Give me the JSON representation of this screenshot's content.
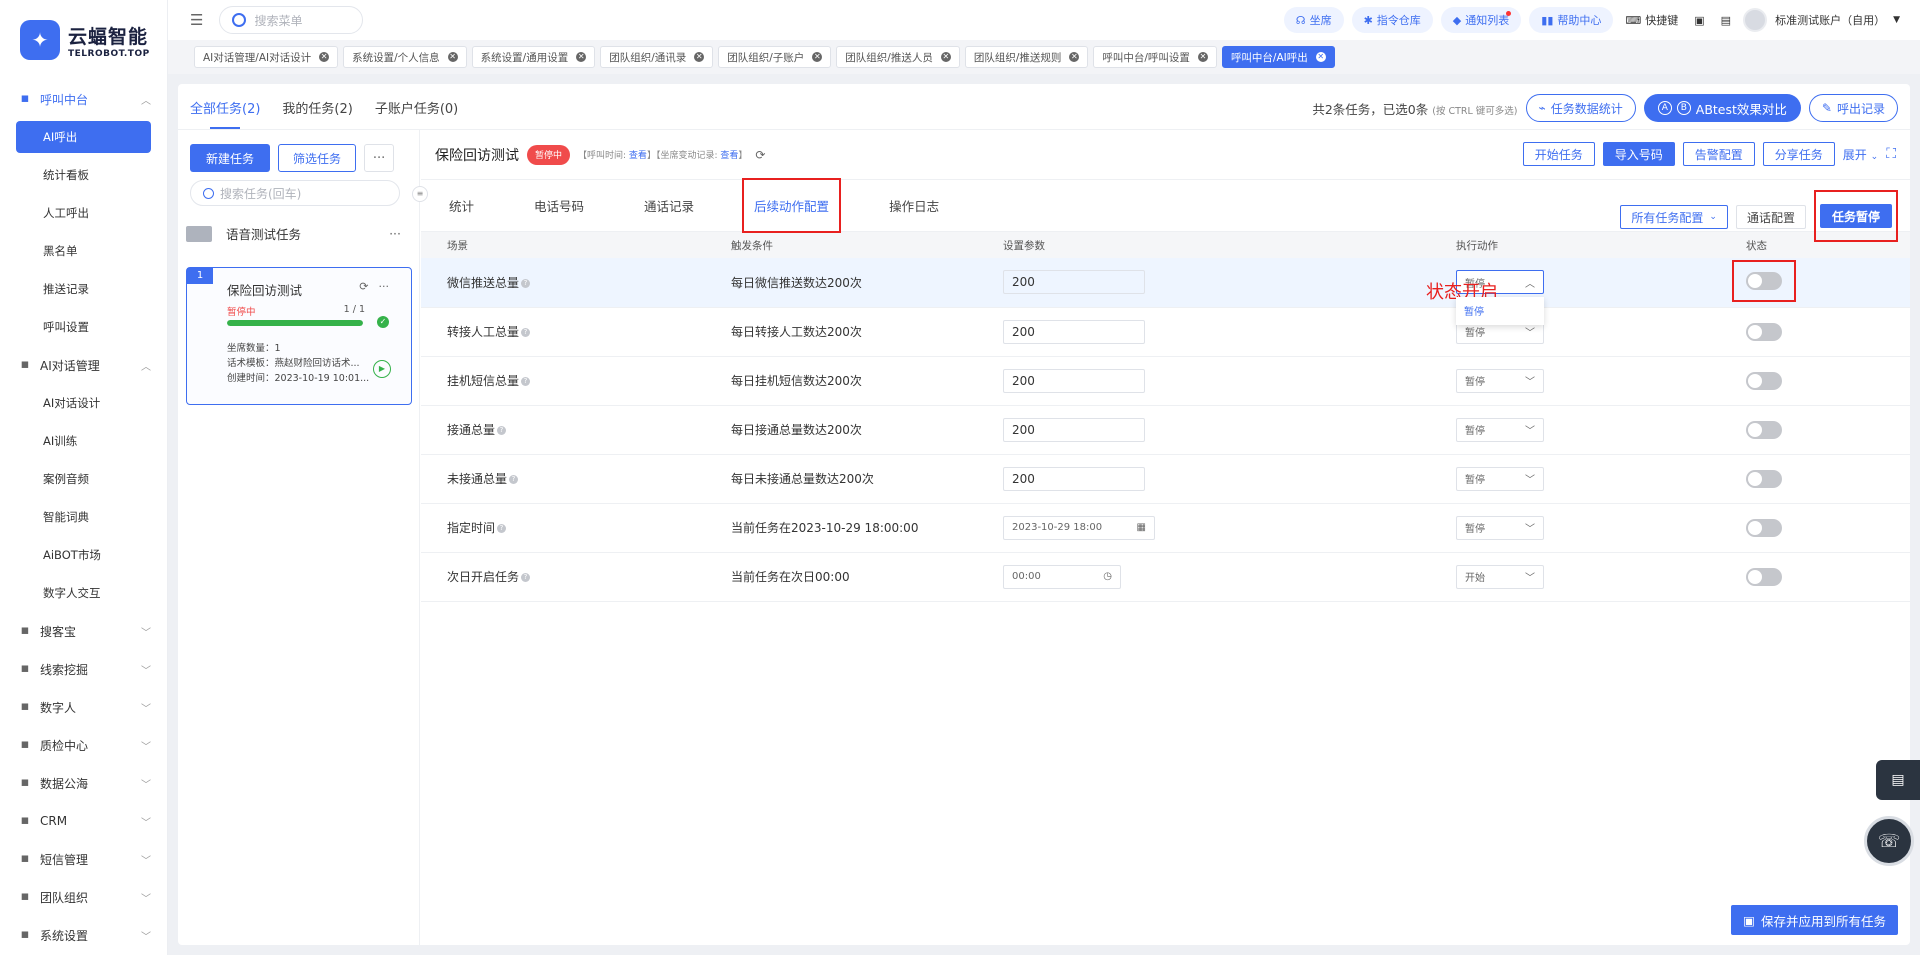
{
  "logo": {
    "title": "云蝠智能",
    "sub": "TELROBOT.TOP"
  },
  "sidebar": {
    "groups": [
      {
        "label": "呼叫中台",
        "icon": "monitor-icon",
        "active": true,
        "subs": [
          {
            "label": "AI呼出",
            "active": true
          },
          {
            "label": "统计看板"
          },
          {
            "label": "人工呼出"
          },
          {
            "label": "黑名单"
          },
          {
            "label": "推送记录"
          },
          {
            "label": "呼叫设置"
          }
        ]
      },
      {
        "label": "AI对话管理",
        "icon": "grid-icon",
        "subs": [
          {
            "label": "AI对话设计"
          },
          {
            "label": "AI训练"
          },
          {
            "label": "案例音频"
          },
          {
            "label": "智能词典"
          },
          {
            "label": "AiBOT市场"
          },
          {
            "label": "数字人交互"
          }
        ]
      },
      {
        "label": "搜客宝",
        "icon": "search-icon"
      },
      {
        "label": "线索挖掘",
        "icon": "target-icon"
      },
      {
        "label": "数字人",
        "icon": "robot-icon"
      },
      {
        "label": "质检中心",
        "icon": "magnifier-icon"
      },
      {
        "label": "数据公海",
        "icon": "chart-icon"
      },
      {
        "label": "CRM",
        "icon": "crm-icon"
      },
      {
        "label": "短信管理",
        "icon": "message-icon"
      },
      {
        "label": "团队组织",
        "icon": "team-icon"
      },
      {
        "label": "系统设置",
        "icon": "settings-icon"
      }
    ]
  },
  "topbar": {
    "search_placeholder": "搜索菜单",
    "pills": [
      "坐席",
      "指令仓库",
      "通知列表",
      "帮助中心"
    ],
    "links": [
      "快捷键"
    ],
    "user": "标准测试账户（自用）"
  },
  "tags": [
    {
      "label": "AI对话管理/AI对话设计"
    },
    {
      "label": "系统设置/个人信息"
    },
    {
      "label": "系统设置/通用设置"
    },
    {
      "label": "团队组织/通讯录"
    },
    {
      "label": "团队组织/子账户"
    },
    {
      "label": "团队组织/推送人员"
    },
    {
      "label": "团队组织/推送规则"
    },
    {
      "label": "呼叫中台/呼叫设置"
    },
    {
      "label": "呼叫中台/AI呼出",
      "active": true
    }
  ],
  "main": {
    "tabs": [
      "全部任务(2)",
      "我的任务(2)",
      "子账户任务(0)"
    ],
    "info": "共2条任务，已选0条",
    "info_hint": "(按 CTRL 键可多选)",
    "btn_stats": "任务数据统计",
    "btn_ab": "ABtest效果对比",
    "btn_calls": "呼出记录"
  },
  "left": {
    "new_task": "新建任务",
    "filter_task": "筛选任务",
    "more": "···",
    "search_placeholder": "搜索任务(回车)",
    "group": "语音测试任务",
    "card": {
      "num": "1",
      "title": "保险回访测试",
      "status": "暂停中",
      "count": "1 / 1",
      "progress": 1.0,
      "line1": "坐席数量：1",
      "line2": "话术模板：燕赵财险回访话术...",
      "line3": "创建时间：2023-10-19 10:01..."
    }
  },
  "right": {
    "title": "保险回访测试",
    "badge": "暂停中",
    "meta1": "【呼叫时间: ",
    "view": "查看",
    "meta2": "】【坐席变动记录: ",
    "meta3": "】",
    "actions": [
      "开始任务",
      "导入号码",
      "告警配置",
      "分享任务"
    ],
    "expand": "展开",
    "subtabs": [
      "统计",
      "电话号码",
      "通话记录",
      "后续动作配置",
      "操作日志"
    ],
    "cfg": "所有任务配置",
    "call_cfg": "通话配置",
    "pause": "任务暂停",
    "headers": [
      "场景",
      "触发条件",
      "设置参数",
      "执行动作",
      "状态"
    ],
    "rows": [
      {
        "scene": "微信推送总量",
        "cond": "每日微信推送数达200次",
        "param": "200",
        "action": "暂停",
        "on": false
      },
      {
        "scene": "转接人工总量",
        "cond": "每日转接人工数达200次",
        "param": "200",
        "action": "暂停",
        "on": false
      },
      {
        "scene": "挂机短信总量",
        "cond": "每日挂机短信数达200次",
        "param": "200",
        "action": "暂停",
        "on": false
      },
      {
        "scene": "接通总量",
        "cond": "每日接通总量数达200次",
        "param": "200",
        "action": "暂停",
        "on": false
      },
      {
        "scene": "未接通总量",
        "cond": "每日未接通总量数达200次",
        "param": "200",
        "action": "暂停",
        "on": false
      },
      {
        "scene": "指定时间",
        "cond": "当前任务在2023-10-29 18:00:00",
        "param": "2023-10-29 18:00",
        "action": "暂停",
        "on": false
      },
      {
        "scene": "次日开启任务",
        "cond": "当前任务在次日00:00",
        "param": "00:00",
        "action": "开始",
        "on": false
      }
    ],
    "dropdown_option": "暂停",
    "annotation": "状态开启",
    "save": "保存并应用到所有任务"
  }
}
